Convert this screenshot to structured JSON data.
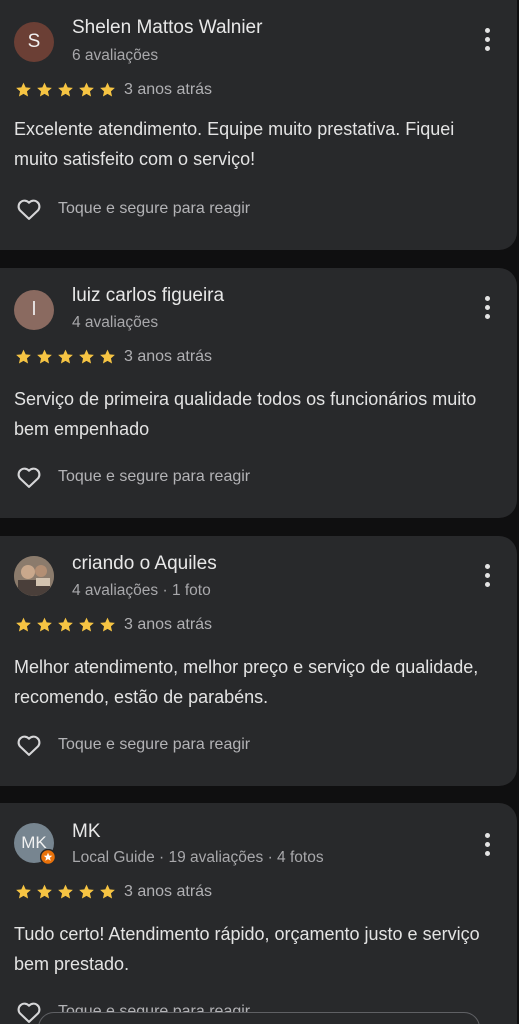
{
  "reviews": [
    {
      "avatar_letter": "S",
      "avatar_color": "#6b3f35",
      "name": "Shelen Mattos Walnier",
      "subtitle": "6 avaliações",
      "stars": 5,
      "time": "3 anos atrás",
      "text": "Excelente atendimento. Equipe muito prestativa. Fiquei muito satisfeito com o serviço!",
      "react_label": "Toque e segure para reagir"
    },
    {
      "avatar_letter": "l",
      "avatar_color": "#8a6a60",
      "name": "luiz carlos figueira",
      "subtitle": "4 avaliações",
      "stars": 5,
      "time": "3 anos atrás",
      "text": "Serviço de primeira qualidade todos os funcionários muito bem empenhado",
      "react_label": "Toque e segure para reagir"
    },
    {
      "avatar_letter": "",
      "avatar_color": "#7a6b5e",
      "name": "criando o Aquiles",
      "subtitle": "4 avaliações · 1 foto",
      "stars": 5,
      "time": "3 anos atrás",
      "text": "Melhor atendimento, melhor preço e serviço de qualidade, recomendo, estão de parabéns.",
      "react_label": "Toque e segure para reagir"
    },
    {
      "avatar_letter": "MK",
      "avatar_color": "#778590",
      "name": "MK",
      "subtitle": "Local Guide · 19 avaliações · 4 fotos",
      "stars": 5,
      "time": "3 anos atrás",
      "text": "Tudo certo! Atendimento rápido, orçamento justo e serviço bem prestado.",
      "react_label": "Toque e segure para reagir"
    }
  ],
  "colors": {
    "star": "#f6c443",
    "card_bg": "#28292b",
    "page_bg": "#0f0f10",
    "local_guide_badge": "#e8710a"
  },
  "icons": [
    "heart-outline-icon",
    "star-icon",
    "more-vert-icon",
    "local-guide-badge-icon"
  ]
}
